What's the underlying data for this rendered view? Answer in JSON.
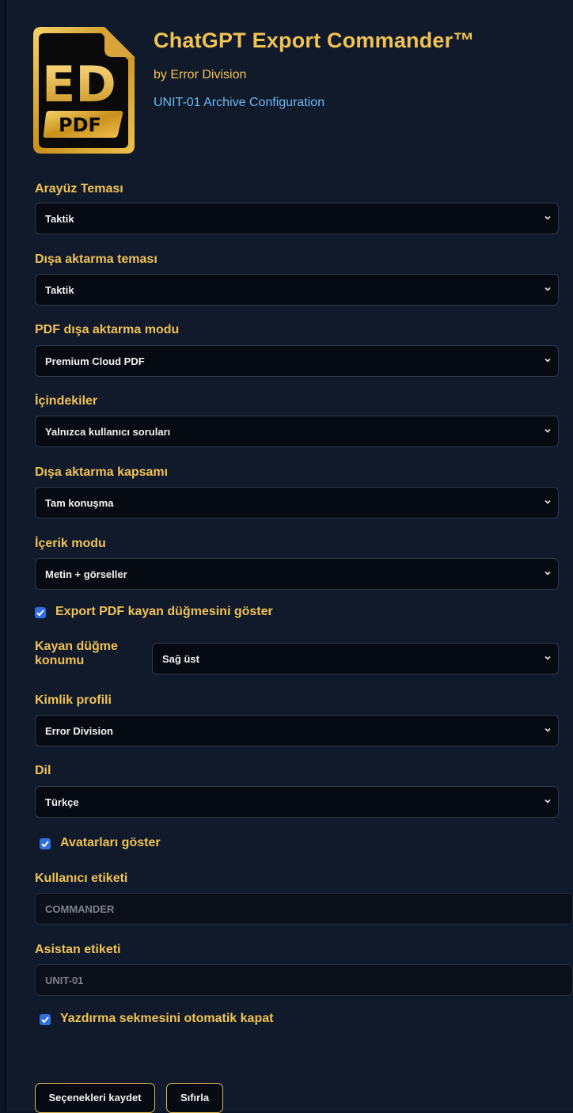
{
  "header": {
    "title": "ChatGPT Export Commander™",
    "byline": "by Error Division",
    "subtitle": "UNIT-01 Archive Configuration",
    "logo": {
      "main_text": "ED",
      "badge_text": "PDF",
      "icon": "ed-pdf-file-logo"
    }
  },
  "fields": {
    "ui_theme": {
      "label": "Arayüz Teması",
      "value": "Taktik"
    },
    "export_theme": {
      "label": "Dışa aktarma teması",
      "value": "Taktik"
    },
    "pdf_mode": {
      "label": "PDF dışa aktarma modu",
      "value": "Premium Cloud PDF"
    },
    "toc": {
      "label": "İçindekiler",
      "value": "Yalnızca kullanıcı soruları"
    },
    "scope": {
      "label": "Dışa aktarma kapsamı",
      "value": "Tam konuşma"
    },
    "content_mode": {
      "label": "İçerik modu",
      "value": "Metin + görseller"
    },
    "float_button": {
      "label": "Export PDF kayan düğmesini göster",
      "checked": true
    },
    "float_position": {
      "label_line1": "Kayan düğme",
      "label_line2": "konumu",
      "value": "Sağ üst"
    },
    "identity": {
      "label": "Kimlik profili",
      "value": "Error Division"
    },
    "language": {
      "label": "Dil",
      "value": "Türkçe"
    },
    "avatars": {
      "label": "Avatarları göster",
      "checked": true
    },
    "user_label": {
      "label": "Kullanıcı etiketi",
      "value": "COMMANDER"
    },
    "assistant_label": {
      "label": "Asistan etiketi",
      "value": "UNIT-01"
    },
    "auto_close": {
      "label": "Yazdırma sekmesini otomatik kapat",
      "checked": true
    }
  },
  "buttons": {
    "save": "Seçenekleri kaydet",
    "reset": "Sıfırla"
  },
  "colors": {
    "accent_gold": "#f0c254",
    "link_blue": "#6fb8f0",
    "checkbox_blue": "#2f6fe0",
    "panel_bg": "#111a2b",
    "field_bg": "#050a13"
  }
}
